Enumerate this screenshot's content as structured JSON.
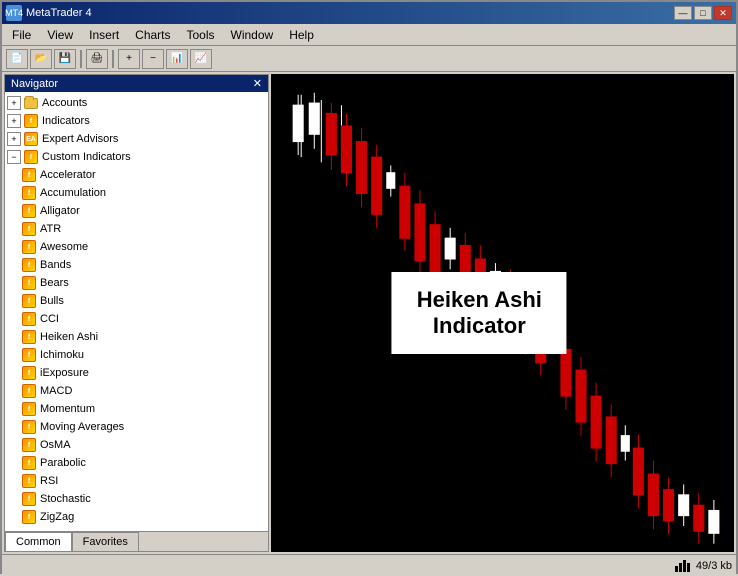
{
  "titlebar": {
    "title": "MetaTrader 4",
    "icon": "MT4",
    "controls": {
      "minimize": "—",
      "maximize": "□",
      "close": "✕"
    }
  },
  "menubar": {
    "items": [
      "File",
      "View",
      "Insert",
      "Charts",
      "Tools",
      "Window",
      "Help"
    ]
  },
  "navigator": {
    "title": "Navigator",
    "close_btn": "✕",
    "tree": {
      "accounts": "Accounts",
      "indicators": "Indicators",
      "expert_advisors": "Expert Advisors",
      "custom_indicators": "Custom Indicators",
      "items": [
        "Accelerator",
        "Accumulation",
        "Alligator",
        "ATR",
        "Awesome",
        "Bands",
        "Bears",
        "Bulls",
        "CCI",
        "Heiken Ashi",
        "Ichimoku",
        "iExposure",
        "MACD",
        "Momentum",
        "Moving Averages",
        "OsMA",
        "Parabolic",
        "RSI",
        "Stochastic",
        "ZigZag"
      ]
    },
    "tabs": {
      "common": "Common",
      "favorites": "Favorites"
    }
  },
  "chart": {
    "label_line1": "Heiken Ashi",
    "label_line2": "Indicator"
  },
  "statusbar": {
    "bars_label": "49/3 kb"
  }
}
